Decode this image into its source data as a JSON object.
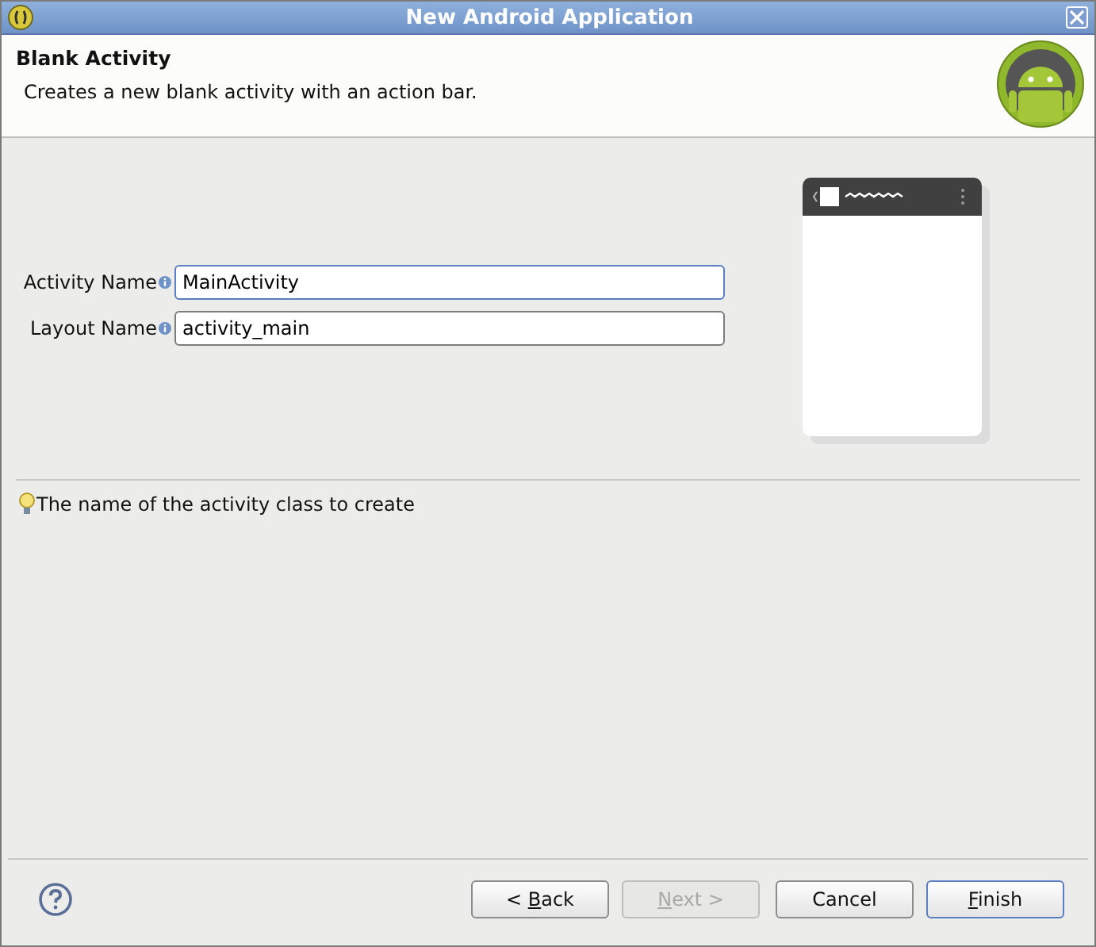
{
  "window": {
    "title": "New Android Application"
  },
  "header": {
    "title": "Blank Activity",
    "description": "Creates a new blank activity with an action bar."
  },
  "fields": [
    {
      "label": "Activity Name",
      "value": "MainActivity",
      "focused": true
    },
    {
      "label": "Layout Name",
      "value": "activity_main",
      "focused": false
    }
  ],
  "hint": "The name of the activity class to create",
  "buttons": [
    {
      "pre": "< ",
      "key": "B",
      "post": "ack",
      "disabled": false,
      "default": false
    },
    {
      "key": "N",
      "post": "ext >",
      "disabled": true,
      "default": false
    },
    {
      "post": "Cancel",
      "disabled": false,
      "default": false
    },
    {
      "key": "F",
      "post": "inish",
      "disabled": false,
      "default": true
    }
  ]
}
